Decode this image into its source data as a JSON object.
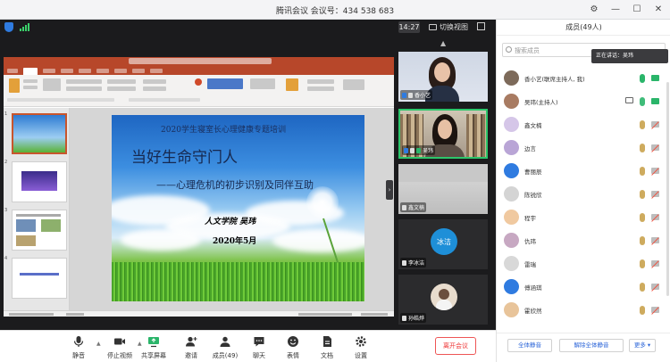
{
  "titlebar": {
    "title": "腾讯会议 会议号：434 538 683"
  },
  "status": {
    "time": "14:27",
    "switch_view": "切换视图"
  },
  "slide": {
    "line1": "2020学生寝室长心理健康专题培训",
    "line2": "当好生命守门人",
    "line3": "——心理危机的初步识别及同伴互助",
    "line4": "人文学院 吴玮",
    "line5": "2020年5月"
  },
  "thumbs": [
    "1",
    "2",
    "3",
    "4"
  ],
  "video": {
    "tile1": {
      "name": "香小艺"
    },
    "tile2": {
      "name": "吴玮"
    },
    "tile3": {
      "name": "鑫文楠"
    },
    "tile4": {
      "name": "李冰洁",
      "avatar_text": "冰洁",
      "avatar_color": "#1e8fd8"
    },
    "tile5": {
      "name": "孙皓烨"
    }
  },
  "toolbar": {
    "mute": "静音",
    "stop_video": "停止视频",
    "share_screen": "共享屏幕",
    "invite": "邀请",
    "members": "成员(49)",
    "chat": "聊天",
    "reactions": "表情",
    "docs": "文档",
    "settings": "设置",
    "leave": "离开会议"
  },
  "members_panel": {
    "title": "成员(49人)",
    "search_placeholder": "搜索成员",
    "speaking": "正在讲话：吴玮",
    "items": [
      {
        "name": "香小艺(联席主持人, 我)",
        "av": "#7d6a5a",
        "mic": "#2ab56a"
      },
      {
        "name": "吴玮(主持人)",
        "av": "#a87b62",
        "mic": "#2ab56a"
      },
      {
        "name": "鑫文楠",
        "av": "#d5c6e8",
        "mic": "#c9a24d"
      },
      {
        "name": "边言",
        "av": "#b9a5d6",
        "mic": "#c9a24d"
      },
      {
        "name": "曹丽辰",
        "av": "#2f7be0",
        "mic": "#c9a24d"
      },
      {
        "name": "陈锐欣",
        "av": "#d4d4d4",
        "mic": "#c9a24d"
      },
      {
        "name": "程宇",
        "av": "#f0c9a0",
        "mic": "#c9a24d"
      },
      {
        "name": "仇玮",
        "av": "#c7a8c2",
        "mic": "#c9a24d"
      },
      {
        "name": "雷瑞",
        "av": "#d8d8d8",
        "mic": "#c9a24d"
      },
      {
        "name": "傅涵琪",
        "av": "#2f7be0",
        "mic": "#c9a24d"
      },
      {
        "name": "霍欣然",
        "av": "#e8c49a",
        "mic": "#c9a24d"
      }
    ],
    "mute_all": "全体静音",
    "unmute_all": "解除全体静音",
    "more": "更多"
  }
}
